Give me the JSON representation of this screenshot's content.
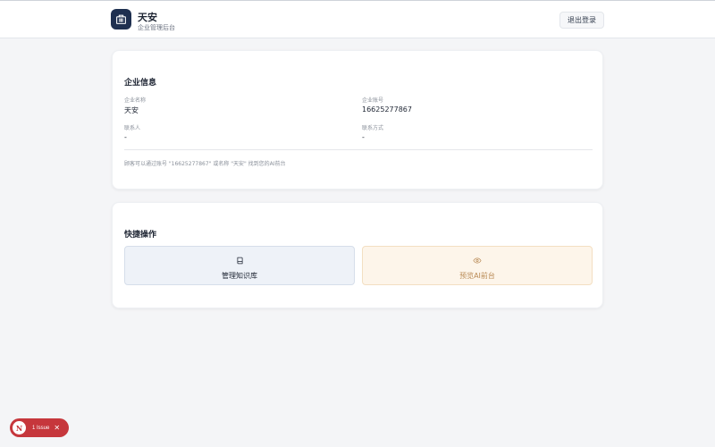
{
  "header": {
    "brand_icon": "building-icon",
    "title": "天安",
    "subtitle": "企业管理后台",
    "logout_label": "退出登录"
  },
  "enterprise_info": {
    "title": "企业信息",
    "name_label": "企业名称",
    "name_value": "天安",
    "account_label": "企业账号",
    "account_value": "16625277867",
    "contact_label": "联系人",
    "contact_value": "-",
    "contact_method_label": "联系方式",
    "contact_method_value": "-",
    "note": "顾客可以通过账号 \"16625277867\" 或名称 \"天安\" 找到您的AI前台"
  },
  "quick_actions": {
    "title": "快捷操作",
    "items": [
      {
        "label": "管理知识库",
        "icon": "book-icon"
      },
      {
        "label": "预览AI前台",
        "icon": "eye-icon"
      }
    ]
  },
  "dev_overlay": {
    "badge_letter": "N",
    "issue_text": "1 Issue",
    "close_symbol": "✕"
  },
  "colors": {
    "brand": "#1f3050",
    "preview_accent": "#b98a55",
    "issue_red": "#c6373c"
  }
}
